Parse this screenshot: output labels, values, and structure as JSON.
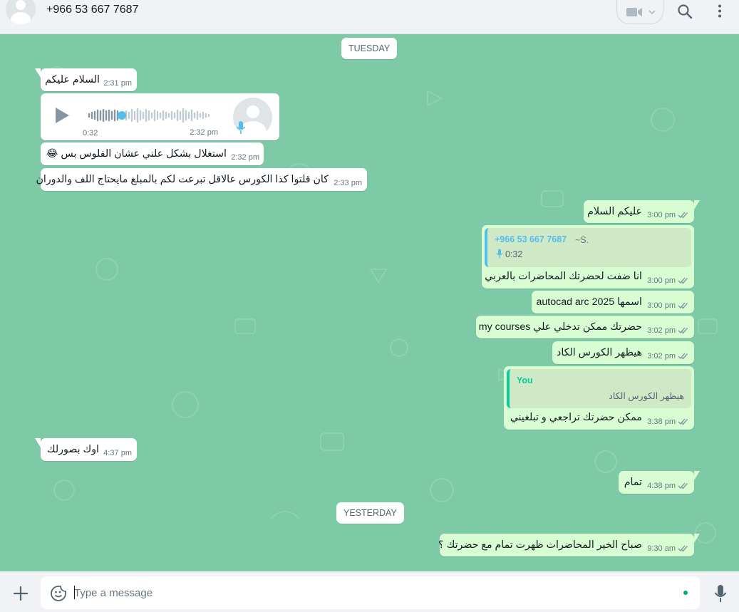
{
  "header": {
    "contact": "+966 53 667 7687"
  },
  "dates": {
    "tuesday": "TUESDAY",
    "yesterday": "YESTERDAY"
  },
  "messages": [
    {
      "dir": "in",
      "text": "السلام عليكم",
      "time": "2:31 pm"
    },
    {
      "dir": "in",
      "type": "voice",
      "duration": "0:32",
      "time": "2:32 pm"
    },
    {
      "dir": "in",
      "text": "استغلال بشكل علني عشان الفلوس بس 😂",
      "time": "2:32 pm"
    },
    {
      "dir": "in",
      "text": "كان قلتوا كذا الكورس عالاقل تبرعت لكم بالمبلغ مايحتاج اللف والدوران",
      "time": "2:33 pm"
    },
    {
      "dir": "out",
      "text": "عليكم السلام",
      "time": "3:00 pm"
    },
    {
      "dir": "out",
      "quote_author": "+966 53 667 7687",
      "quote_name": "~S.",
      "quote_text": "0:32",
      "text": "انا ضفت لحضرتك المحاضرات بالعربي",
      "time": "3:00 pm"
    },
    {
      "dir": "out",
      "text": "اسمها autocad arc 2025",
      "time": "3:00 pm"
    },
    {
      "dir": "out",
      "text": "حضرتك ممكن تدخلي علي my courses",
      "time": "3:02 pm"
    },
    {
      "dir": "out",
      "text": "هيظهر الكورس الكاد",
      "time": "3:02 pm"
    },
    {
      "dir": "out",
      "quote_author": "You",
      "quote_text": "هيظهر الكورس الكاد",
      "text": "ممكن حضرتك تراجعي و تبلغيني",
      "time": "3:38 pm"
    },
    {
      "dir": "in",
      "text": "اوك بصورلك",
      "time": "4:37 pm"
    },
    {
      "dir": "out",
      "text": "تمام",
      "time": "4:38 pm"
    },
    {
      "dir": "out",
      "text": "صباح الخير المحاضرات ظهرت تمام مع حضرتك ؟",
      "time": "9:30 am"
    }
  ],
  "composer": {
    "placeholder": "Type a message"
  },
  "colors": {
    "chat_bg": "#7ecaa6",
    "incoming": "#ffffff",
    "outgoing": "#d9fdd3",
    "accent": "#00a884",
    "quote_bar": "#53bdeb",
    "tick": "#8696a0"
  },
  "icons": [
    "avatar-icon",
    "video-call-icon",
    "chevron-down-icon",
    "search-icon",
    "menu-icon",
    "play-icon",
    "mic-icon",
    "double-tick-icon",
    "plus-icon",
    "emoji-icon"
  ]
}
